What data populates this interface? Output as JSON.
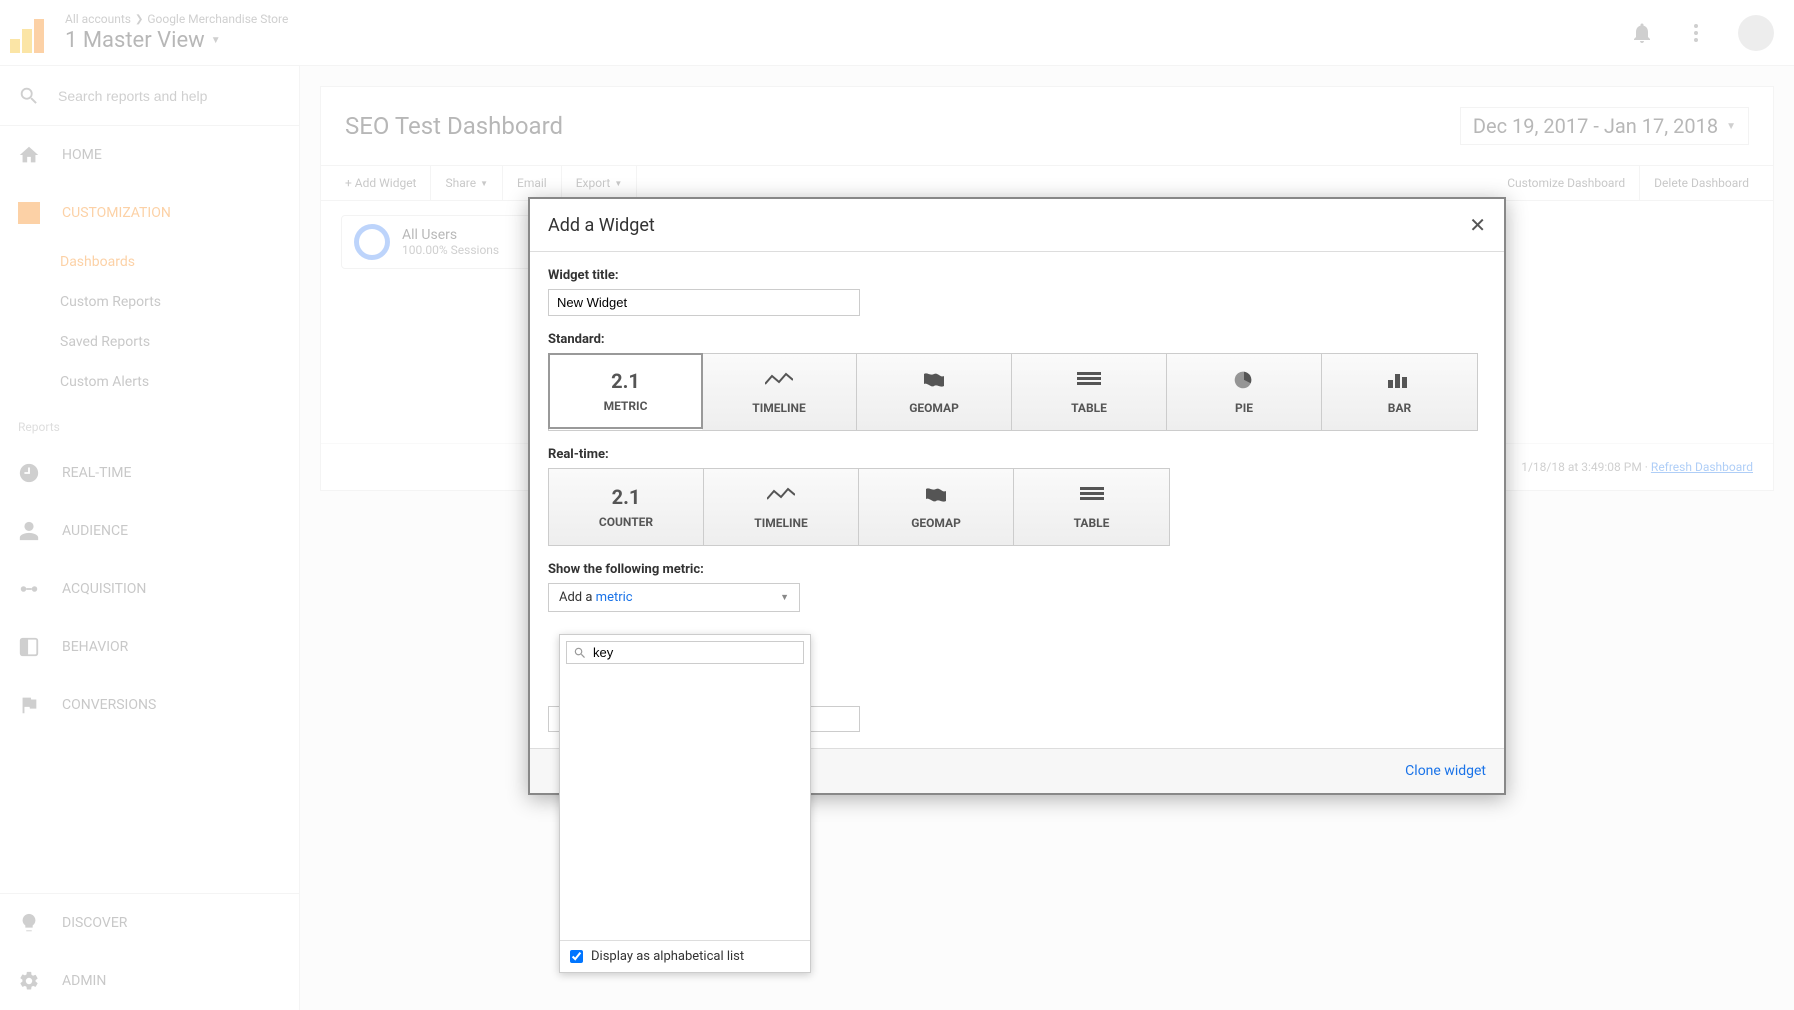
{
  "header": {
    "breadcrumb_all": "All accounts",
    "breadcrumb_store": "Google Merchandise Store",
    "view_name": "1 Master View"
  },
  "sidebar": {
    "search_placeholder": "Search reports and help",
    "home": "HOME",
    "customization": "CUSTOMIZATION",
    "sub": {
      "dashboards": "Dashboards",
      "custom_reports": "Custom Reports",
      "saved_reports": "Saved Reports",
      "custom_alerts": "Custom Alerts"
    },
    "reports_label": "Reports",
    "realtime": "REAL-TIME",
    "audience": "AUDIENCE",
    "acquisition": "ACQUISITION",
    "behavior": "BEHAVIOR",
    "conversions": "CONVERSIONS",
    "discover": "DISCOVER",
    "admin": "ADMIN"
  },
  "main": {
    "title": "SEO Test Dashboard",
    "date_range": "Dec 19, 2017 - Jan 17, 2018",
    "toolbar": {
      "add_widget": "+ Add Widget",
      "share": "Share",
      "email": "Email",
      "export": "Export",
      "customize": "Customize Dashboard",
      "delete": "Delete Dashboard"
    },
    "segment": {
      "name": "All Users",
      "sub": "100.00% Sessions"
    },
    "refresh_ts": "1/18/18 at 3:49:08 PM · ",
    "refresh_link": "Refresh Dashboard"
  },
  "modal": {
    "title": "Add a Widget",
    "widget_title_label": "Widget title:",
    "widget_title_value": "New Widget",
    "standard_label": "Standard:",
    "realtime_label": "Real-time:",
    "types": {
      "metric": "METRIC",
      "metric_num": "2.1",
      "timeline": "TIMELINE",
      "geomap": "GEOMAP",
      "table": "TABLE",
      "pie": "PIE",
      "bar": "BAR",
      "counter": "COUNTER",
      "counter_num": "2.1"
    },
    "show_metric_label": "Show the following metric:",
    "add_a": "Add a ",
    "metric_link": "metric",
    "clone": "Clone widget"
  },
  "dropdown": {
    "search_value": "key",
    "alpha_label": "Display as alphabetical list"
  }
}
